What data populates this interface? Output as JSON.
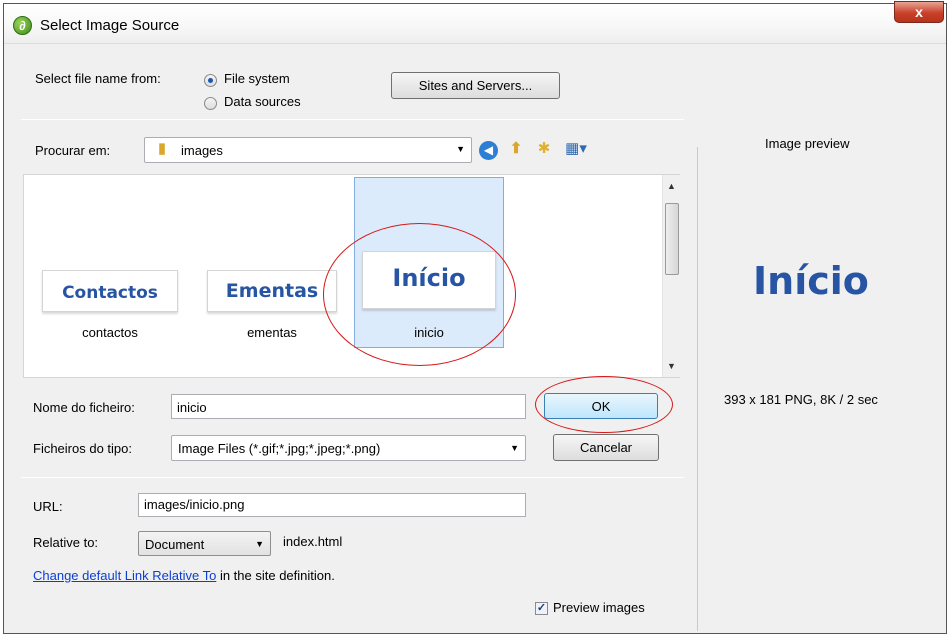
{
  "window": {
    "title": "Select Image Source",
    "close_glyph": "x"
  },
  "source": {
    "label": "Select file name from:",
    "options": [
      "File system",
      "Data sources"
    ],
    "selected": "File system",
    "sites_button": "Sites and Servers..."
  },
  "lookin": {
    "label": "Procurar em:",
    "folder": "images"
  },
  "files": [
    {
      "thumb_text": "Contactos",
      "name": "contactos"
    },
    {
      "thumb_text": "Ementas",
      "name": "ementas"
    },
    {
      "thumb_text": "Início",
      "name": "inicio"
    }
  ],
  "filename": {
    "label": "Nome do ficheiro:",
    "value": "inicio"
  },
  "filetype": {
    "label": "Ficheiros do tipo:",
    "value": "Image Files (*.gif;*.jpg;*.jpeg;*.png)"
  },
  "buttons": {
    "ok": "OK",
    "cancel": "Cancelar"
  },
  "url": {
    "label": "URL:",
    "value": "images/inicio.png"
  },
  "relative": {
    "label": "Relative to:",
    "value": "Document",
    "file": "index.html"
  },
  "link_line": {
    "link_text": "Change default Link Relative To",
    "rest": " in the site definition."
  },
  "preview_images": {
    "label": "Preview images",
    "checked": true
  },
  "preview": {
    "title": "Image preview",
    "image_text": "Início",
    "info": "393 x 181 PNG, 8K / 2 sec"
  },
  "colors": {
    "annotation": "#d41a1a",
    "thumb_text": "#2755a3",
    "selection": "#dcebfc"
  }
}
